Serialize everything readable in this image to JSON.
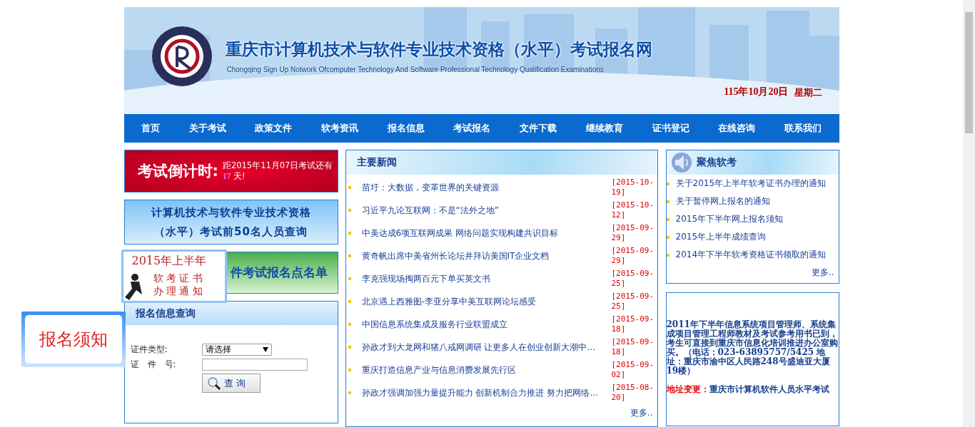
{
  "header": {
    "title": "重庆市计算机技术与软件专业技术资格（水平）考试报名网",
    "subtitle": "Chongqing Sign Up Notwork Ofcomputer Technology And Software Professional Technology Qualification Examinations",
    "date": "115年10月20日",
    "weekday": "星期二"
  },
  "nav": [
    "首页",
    "关于考试",
    "政策文件",
    "软考资讯",
    "报名信息",
    "考试报名",
    "文件下载",
    "继续教育",
    "证书登记",
    "在线咨询",
    "联系我们"
  ],
  "countdown": {
    "title": "考试倒计时:",
    "text": "距2015年11月07日考试还有",
    "days": "17",
    "unit": " 天!"
  },
  "top50_banner": {
    "line1": "计算机技术与软件专业技术资格",
    "line2": "（水平）考试前50名人员查询"
  },
  "sites_banner": "件考试报名点名单",
  "float_ad": {
    "line1": "2015年上半年",
    "line2": "软 考 证 书",
    "line3": "办 理 通 知"
  },
  "notice_float": "报名须知",
  "query": {
    "title": "报名信息查询",
    "type_label": "证件类型:",
    "type_value": "请选择",
    "number_label": "证　件　号:",
    "button": "查 询"
  },
  "news": {
    "title": "主要新闻",
    "more": "更多..",
    "items": [
      {
        "title": "苗圩：大数据，变革世界的关键资源",
        "date": "[2015-10-19]"
      },
      {
        "title": "习近平九论互联网：不是“法外之地”",
        "date": "[2015-10-12]"
      },
      {
        "title": "中美达成6项互联网成果 网络问题实现构建共识目标",
        "date": "[2015-09-29]"
      },
      {
        "title": "黄奇帆出席中美省州长论坛并拜访美国IT企业文档",
        "date": "[2015-09-29]"
      },
      {
        "title": "李克强现场掏两百元下单买英文书",
        "date": "[2015-09-25]"
      },
      {
        "title": "北京遇上西雅图-李亚分享中美互联网论坛感受",
        "date": "[2015-09-25]"
      },
      {
        "title": "中国信息系统集成及服务行业联盟成立",
        "date": "[2015-09-18]"
      },
      {
        "title": "孙政才到大龙网和猪八戒网调研 让更多人在创业创新大潮中…",
        "date": "[2015-09-18]"
      },
      {
        "title": "重庆打造信息产业与信息消费发展先行区",
        "date": "[2015-09-02]"
      },
      {
        "title": "孙政才强调加强力量提升能力 创新机制合力推进 努力把网络…",
        "date": "[2015-08-20]"
      }
    ]
  },
  "focus": {
    "title": "聚焦软考",
    "more": "更多..",
    "items": [
      "关于2015年上半年软考证书办理的通知",
      "关于暂停网上报名的通知",
      "2015年下半年网上报名须知",
      "2015年上半年成绩查询",
      "2014年下半年软考资格证书领取的通知"
    ]
  },
  "notice": {
    "text": "2011年下半年信息系统项目管理师、系统集成项目管理工程师教材及考试参考用书已到，考生可直接到重庆市信息化培训推进办公室购买。（电话：023-63895757/5425 地址：重庆市渝中区人民路248号盛迪亚大厦19楼）",
    "change_label": "地址变更：",
    "change_text": "重庆市计算机软件人员水平考试"
  }
}
